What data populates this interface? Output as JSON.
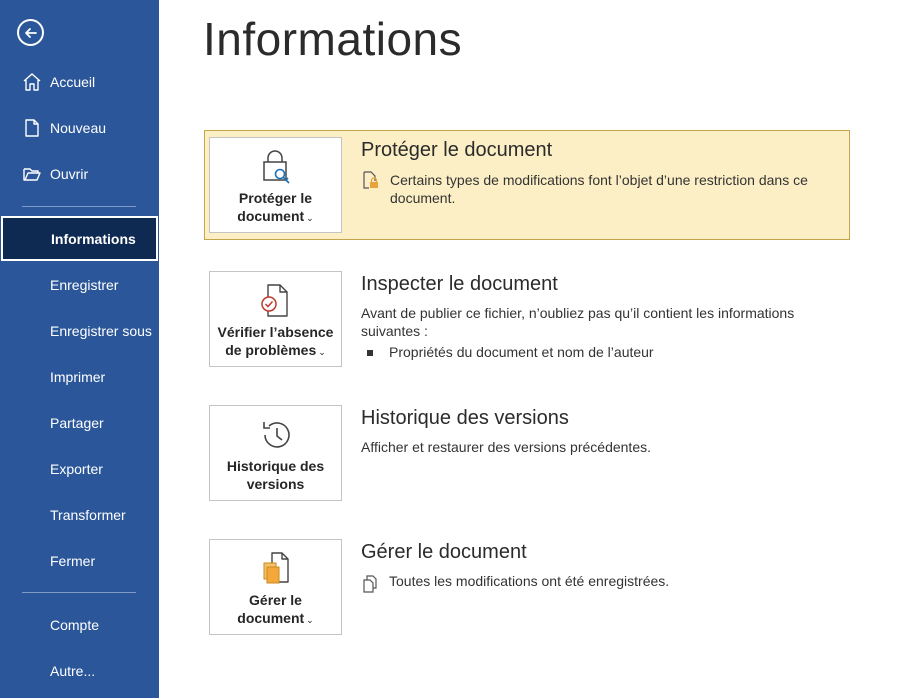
{
  "sidebar": {
    "items": [
      {
        "label": "Accueil",
        "icon": "home-icon"
      },
      {
        "label": "Nouveau",
        "icon": "new-document-icon"
      },
      {
        "label": "Ouvrir",
        "icon": "folder-open-icon"
      },
      {
        "label": "Informations",
        "selected": true
      },
      {
        "label": "Enregistrer"
      },
      {
        "label": "Enregistrer sous"
      },
      {
        "label": "Imprimer"
      },
      {
        "label": "Partager"
      },
      {
        "label": "Exporter"
      },
      {
        "label": "Transformer"
      },
      {
        "label": "Fermer"
      },
      {
        "label": "Compte"
      },
      {
        "label": "Autre..."
      }
    ]
  },
  "main": {
    "title": "Informations",
    "sections": [
      {
        "tile_label_1": "Protéger le",
        "tile_label_2": "document",
        "title": "Protéger le document",
        "description": "Certains types de modifications font l’objet d’une restriction dans ce document.",
        "icon": "lock-key-icon"
      },
      {
        "tile_label_1": "Vérifier l’absence",
        "tile_label_2": "de problèmes",
        "title": "Inspecter le document",
        "description": "Avant de publier ce fichier, n’oubliez pas qu’il contient les informations suivantes :",
        "bullet": "Propriétés du document et nom de l’auteur",
        "icon": "check-document-icon"
      },
      {
        "tile_label_1": "Historique des",
        "tile_label_2": "versions",
        "title": "Historique des versions",
        "description": "Afficher et restaurer des versions précédentes.",
        "icon": "history-clock-icon"
      },
      {
        "tile_label_1": "Gérer le",
        "tile_label_2": "document",
        "title": "Gérer le document",
        "description": "Toutes les modifications ont été enregistrées.",
        "icon": "manage-document-icon"
      }
    ]
  },
  "colors": {
    "sidebar_bg": "#2B579A",
    "selected_bg": "#0F2A52",
    "highlight_bg": "#FCEFC5",
    "highlight_border": "#C4A54B"
  }
}
